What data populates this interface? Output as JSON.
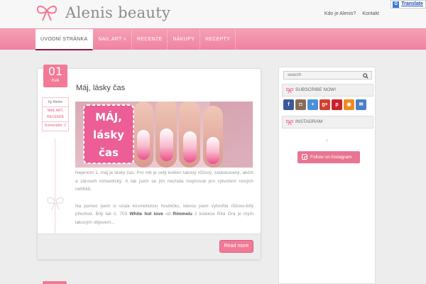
{
  "site": {
    "title": "Alenis beauty"
  },
  "top_links": [
    "Kdo je Alenis?",
    "Kontakt"
  ],
  "translate_label": "Translate",
  "nav": [
    "ÚVODNÍ STRÁNKA",
    "NAIL ART »",
    "RECENZE",
    "NÁKUPY",
    "RECEPTY"
  ],
  "post": {
    "day": "01",
    "month": "Kvě",
    "meta_author": "by Alenis",
    "meta_cat1": "NAIL ART,",
    "meta_cat2": "RECENZE",
    "meta_comments": "Komentáře: 2",
    "title": "Máj, lásky čas",
    "image_caption": [
      "MÁJ,",
      "lásky",
      "čas"
    ],
    "paragraph1": "Nejenom 1. máj je lásky čas. Pro mě je celý květen takový růžový, zaláskovaný, akční a zároveň romantický. A tak jsem se jím nechala inspirovat pro vytvoření nových nehtíků.",
    "paragraph2_a": "Na pomoc jsem si vzala kosmetickou houbičku, kterou jsem vytvořila růžovo-bílý přechod. Bílý lak č. 703",
    "paragraph2_b1": "White hot love",
    "paragraph2_c": "od",
    "paragraph2_b2": "Rimmelu",
    "paragraph2_d": "z kolekce Rita Ora je mým lakovým objevem...",
    "read_more": "Read more"
  },
  "sidebar": {
    "search_placeholder": "search",
    "subscribe_title": "SUBSCRIBE NOW!",
    "instagram_title": "INSTAGRAM",
    "loader": "⁘",
    "follow_button": "Follow on Instagram",
    "socials": [
      {
        "icon": "facebook-icon",
        "glyph": "f",
        "color": "#3b5998"
      },
      {
        "icon": "instagram-icon",
        "glyph": "◘",
        "color": "#8a6b57"
      },
      {
        "icon": "plus-icon",
        "glyph": "+",
        "color": "#4a90d9"
      },
      {
        "icon": "googleplus-icon",
        "glyph": "g+",
        "color": "#d23f2c"
      },
      {
        "icon": "pinterest-icon",
        "glyph": "p",
        "color": "#c8232c"
      },
      {
        "icon": "rss-icon",
        "glyph": "◉",
        "color": "#ef8a22"
      },
      {
        "icon": "email-icon",
        "glyph": "✉",
        "color": "#4a7ec7"
      }
    ]
  },
  "colors": {
    "pink": "#f27a97",
    "nav": "#f083a0",
    "dark_red": "#8c1c3c"
  }
}
